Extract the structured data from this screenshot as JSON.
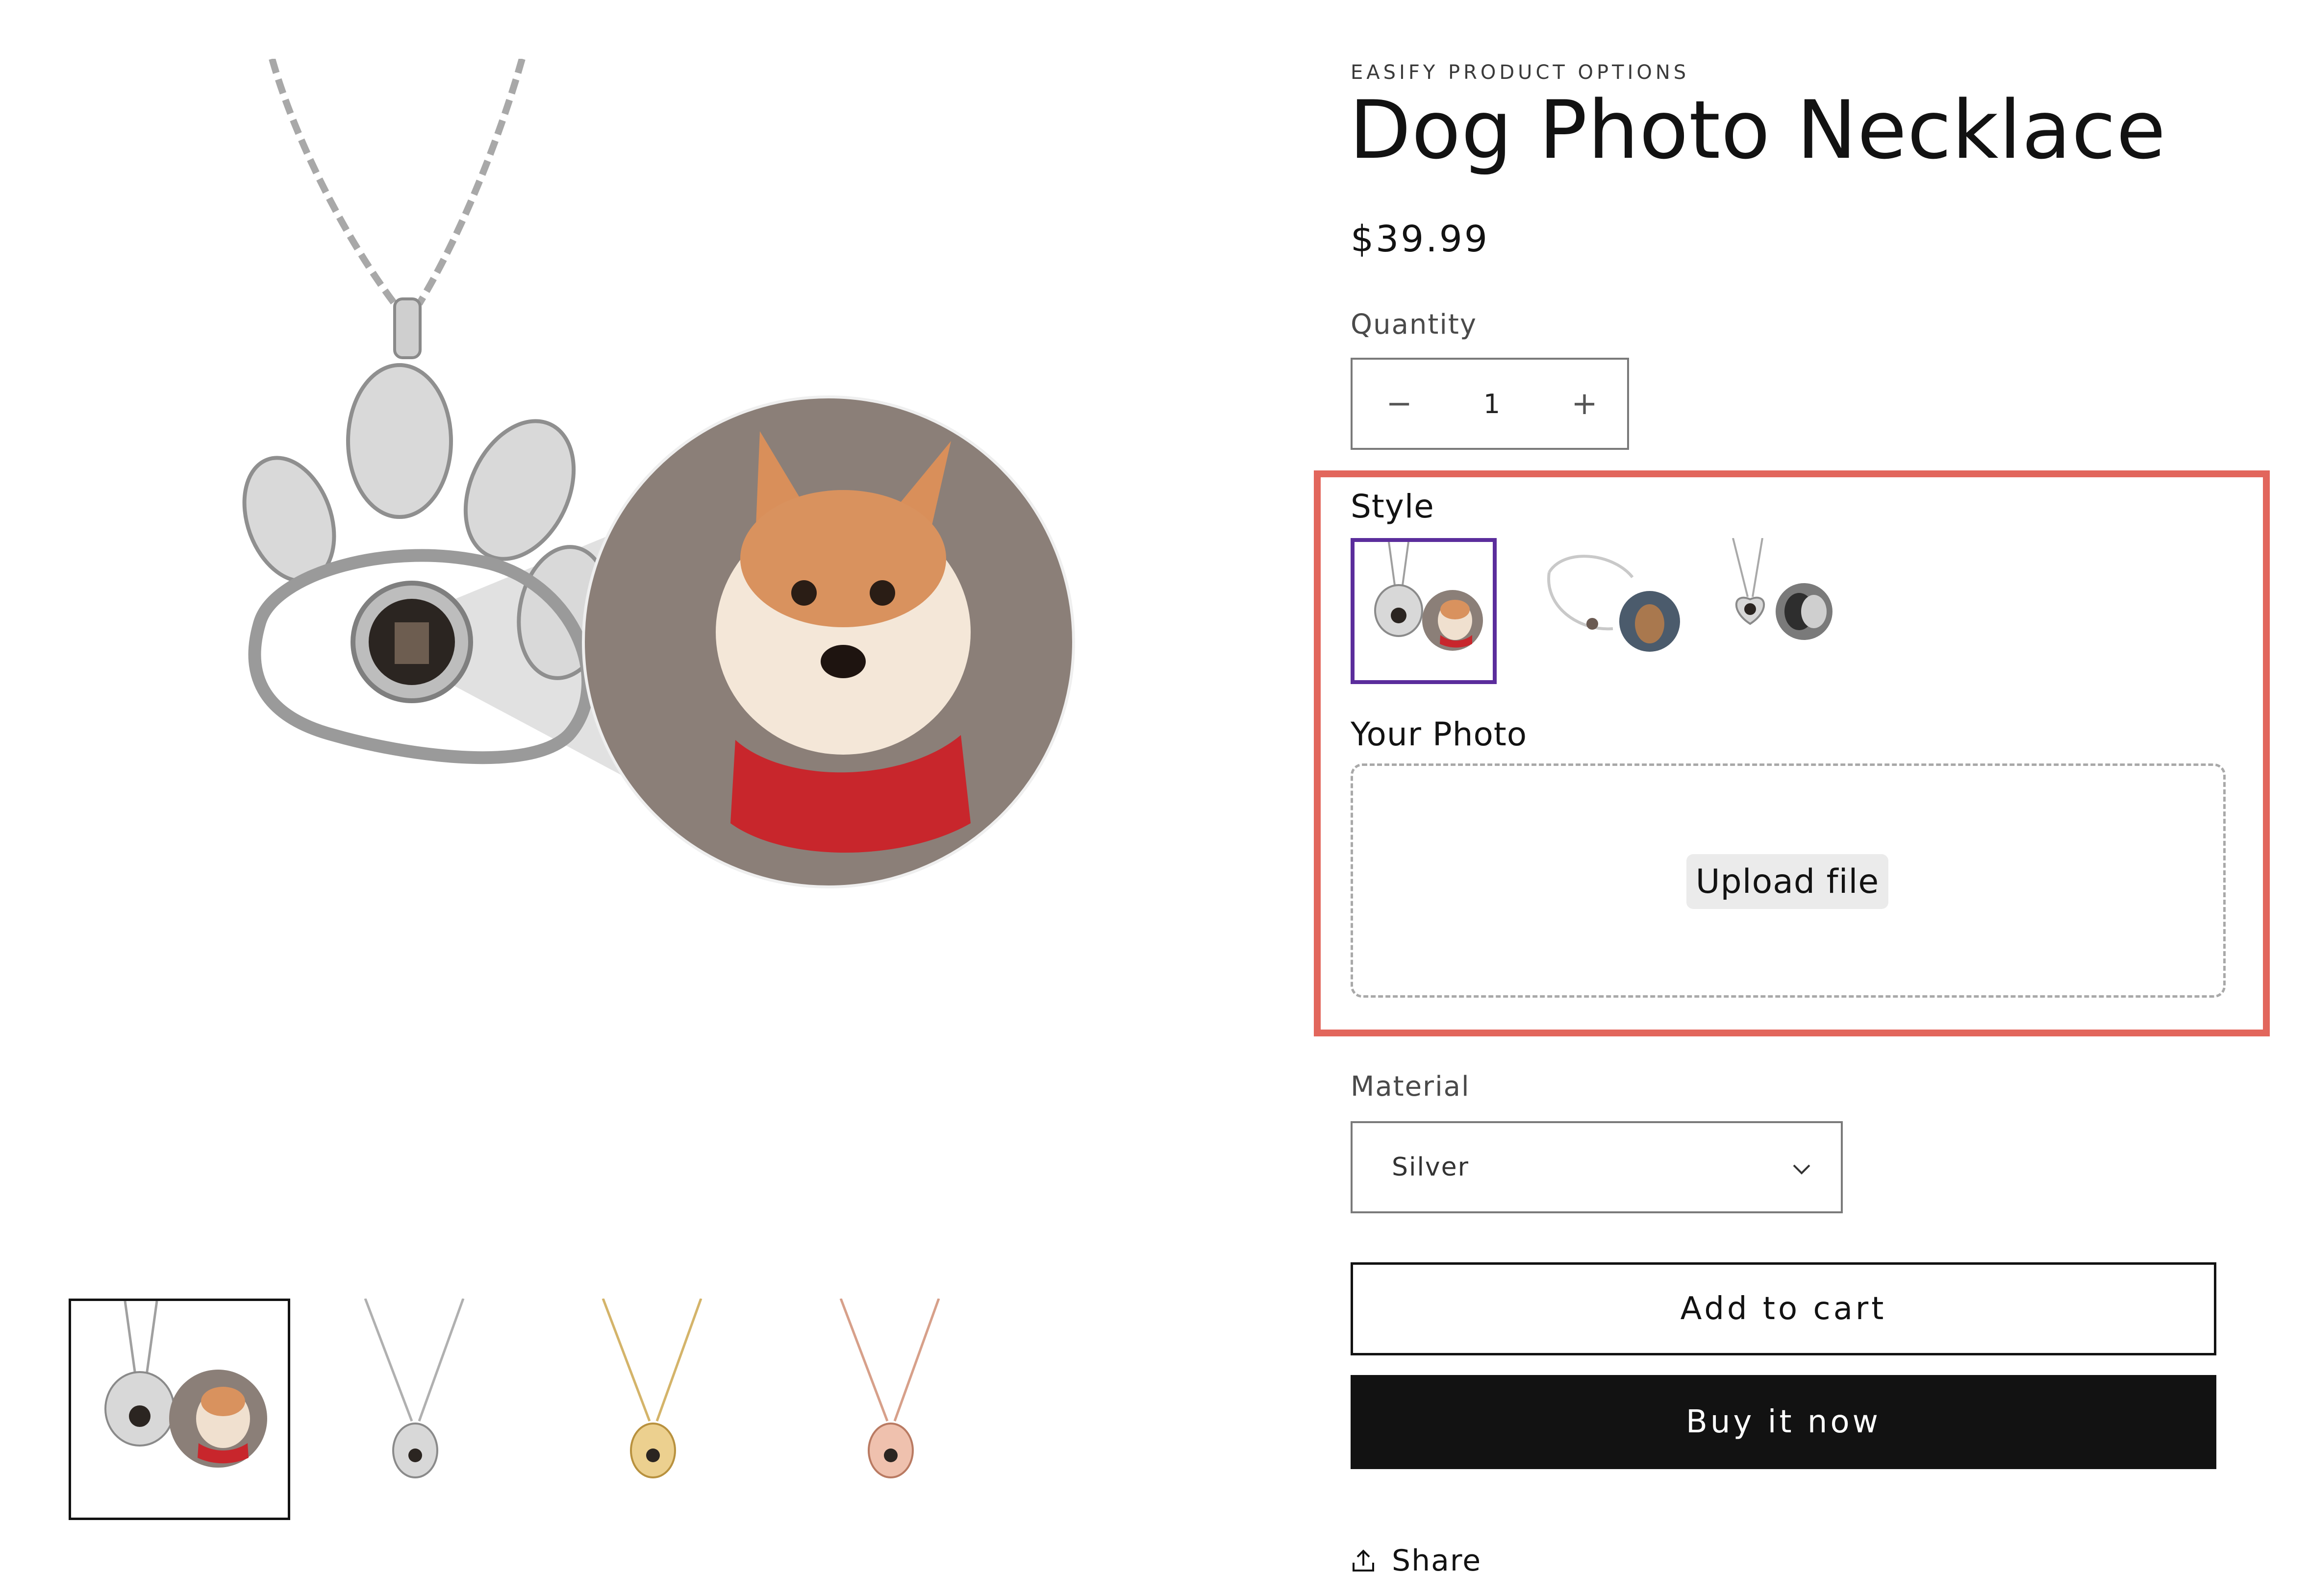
{
  "gallery": {
    "hero_alt": "Dog Photo Necklace main image",
    "thumbnails": [
      {
        "name": "thumb-paw-with-photo",
        "selected": true
      },
      {
        "name": "thumb-silver",
        "selected": false
      },
      {
        "name": "thumb-gold",
        "selected": false
      },
      {
        "name": "thumb-rose-gold",
        "selected": false
      }
    ]
  },
  "product": {
    "vendor": "EASIFY PRODUCT OPTIONS",
    "title": "Dog Photo Necklace",
    "price": "$39.99"
  },
  "quantity": {
    "label": "Quantity",
    "value": "1",
    "decrease_symbol": "−",
    "increase_symbol": "+"
  },
  "options": {
    "style_label": "Style",
    "styles": [
      {
        "name": "paw-pendant",
        "selected": true
      },
      {
        "name": "bracelet",
        "selected": false
      },
      {
        "name": "heart-pendant",
        "selected": false
      }
    ],
    "photo_label": "Your Photo",
    "upload_label": "Upload file",
    "highlight_color": "#e2665c",
    "selected_color": "#5b2d9c"
  },
  "material": {
    "label": "Material",
    "selected": "Silver"
  },
  "actions": {
    "add_to_cart": "Add to cart",
    "buy_now": "Buy it now",
    "share": "Share"
  }
}
